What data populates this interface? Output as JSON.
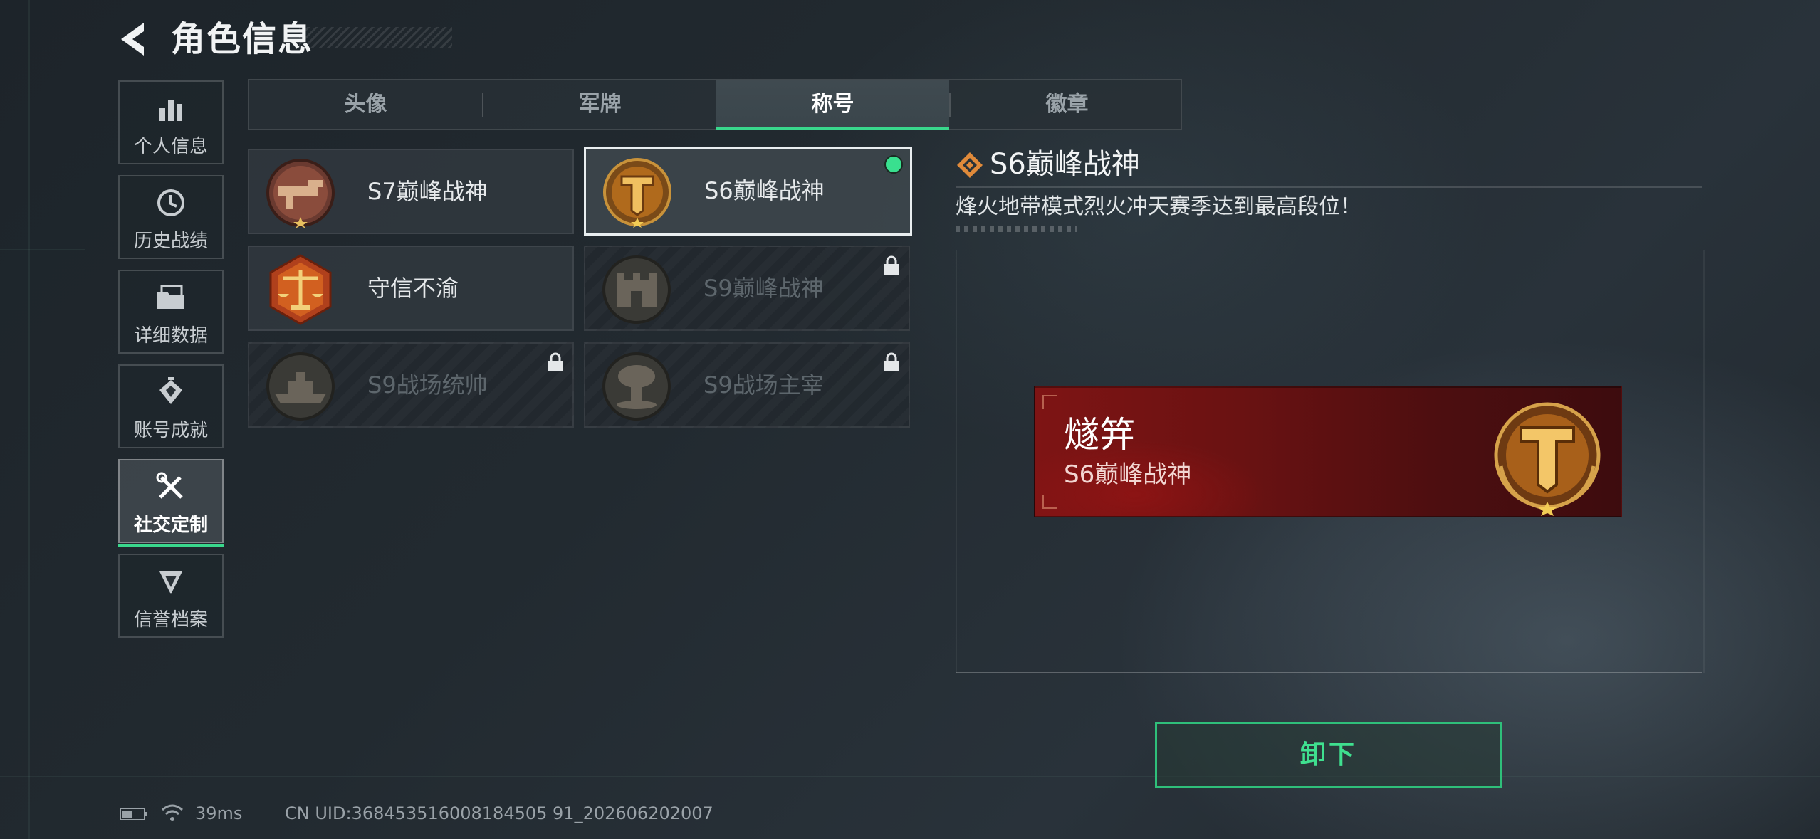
{
  "header": {
    "title": "角色信息"
  },
  "sidebar": {
    "items": [
      {
        "label": "个人信息",
        "icon": "bar-chart-icon"
      },
      {
        "label": "历史战绩",
        "icon": "history-clock-icon"
      },
      {
        "label": "详细数据",
        "icon": "folder-icon"
      },
      {
        "label": "账号成就",
        "icon": "achievement-icon"
      },
      {
        "label": "社交定制",
        "icon": "tools-icon",
        "active": true
      },
      {
        "label": "信誉档案",
        "icon": "credibility-icon"
      }
    ]
  },
  "tabs": [
    {
      "label": "头像"
    },
    {
      "label": "军牌"
    },
    {
      "label": "称号",
      "active": true
    },
    {
      "label": "徽章"
    }
  ],
  "titles": [
    {
      "label": "S7巅峰战神",
      "icon": "weapon-emblem-icon",
      "locked": false
    },
    {
      "label": "S6巅峰战神",
      "icon": "t-shield-emblem-icon",
      "locked": false,
      "selected": true,
      "equipped": true
    },
    {
      "label": "守信不渝",
      "icon": "scales-emblem-icon",
      "locked": false
    },
    {
      "label": "S9巅峰战神",
      "icon": "fortress-emblem-icon",
      "locked": true
    },
    {
      "label": "S9战场统帅",
      "icon": "warship-emblem-icon",
      "locked": true
    },
    {
      "label": "S9战场主宰",
      "icon": "mushroom-cloud-emblem-icon",
      "locked": true
    }
  ],
  "detail": {
    "title": "S6巅峰战神",
    "description": "烽火地带模式烈火冲天赛季达到最高段位！",
    "nameplate": {
      "player_name": "燧笄",
      "title": "S6巅峰战神"
    },
    "action_label": "卸下"
  },
  "status": {
    "ping": "39ms",
    "uid": "CN UID:368453516008184505 91_202606202007"
  },
  "colors": {
    "accent": "#39d78c",
    "nameplate_red": "#7e1414",
    "gold": "#c89a3c"
  }
}
